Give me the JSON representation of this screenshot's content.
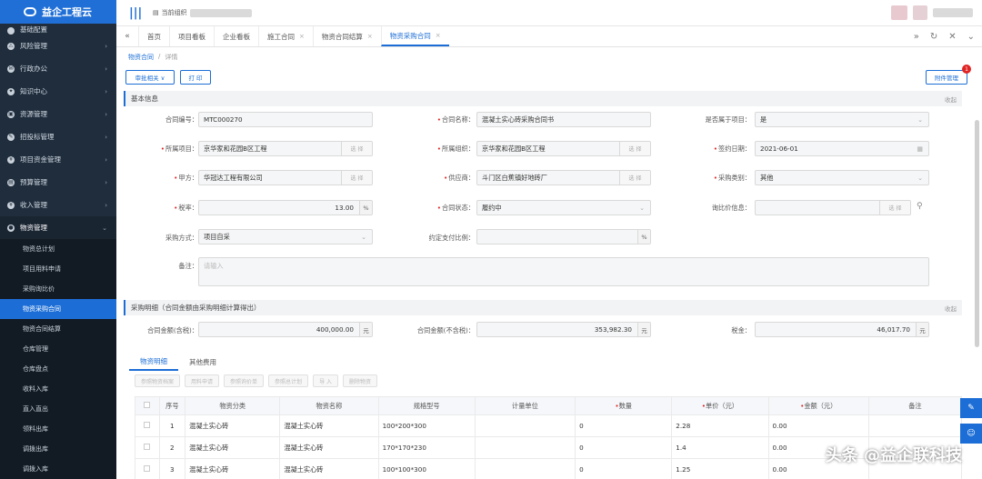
{
  "app": {
    "logo_text": "益企工程云",
    "current_org_label": "当前组织"
  },
  "sidebar": {
    "top_partial": "基础配置",
    "items": [
      {
        "label": "风险管理"
      },
      {
        "label": "行政办公"
      },
      {
        "label": "知识中心"
      },
      {
        "label": "资源管理"
      },
      {
        "label": "招投标管理"
      },
      {
        "label": "项目资金管理"
      },
      {
        "label": "预算管理"
      },
      {
        "label": "收入管理"
      },
      {
        "label": "物资管理"
      }
    ],
    "sub_items": [
      {
        "label": "物资总计划"
      },
      {
        "label": "项目用料申请"
      },
      {
        "label": "采购询比价"
      },
      {
        "label": "物资采购合同"
      },
      {
        "label": "物资合同结算"
      },
      {
        "label": "仓库管理"
      },
      {
        "label": "仓库盘点"
      },
      {
        "label": "收料入库"
      },
      {
        "label": "直入直出"
      },
      {
        "label": "领料出库"
      },
      {
        "label": "调拨出库"
      },
      {
        "label": "调拨入库"
      }
    ]
  },
  "tabs": [
    {
      "label": "首页",
      "closable": false
    },
    {
      "label": "项目看板",
      "closable": false
    },
    {
      "label": "企业看板",
      "closable": false
    },
    {
      "label": "施工合同",
      "closable": true
    },
    {
      "label": "物资合同结算",
      "closable": true
    },
    {
      "label": "物资采购合同",
      "closable": true,
      "active": true
    }
  ],
  "breadcrumb": {
    "parent": "物资合同",
    "sep": "/",
    "current": "详情"
  },
  "buttons": {
    "approval": "审批相关 ∨",
    "print": "打 印",
    "attachments": "附件管理",
    "attach_badge": "1"
  },
  "basic": {
    "title": "基本信息",
    "collapse": "收起",
    "contract_no_label": "合同编号：",
    "contract_no": "MTC000270",
    "contract_name_label": "合同名称：",
    "contract_name": "混凝土实心砖采购合同书",
    "belongs_project_label": "是否属于项目：",
    "belongs_project": "是",
    "project_label": "所属项目：",
    "project": "京华家和花园B区工程",
    "org_label": "所属组织：",
    "org": "京华家和花园B区工程",
    "sign_date_label": "签约日期：",
    "sign_date": "2021-06-01",
    "party_a_label": "甲方：",
    "party_a": "华冠达工程有限公司",
    "supplier_label": "供应商：",
    "supplier": "斗门区白蕉镇好地砖厂",
    "purchase_type_label": "采购类别：",
    "purchase_type": "其他",
    "tax_rate_label": "税率：",
    "tax_rate": "13.00",
    "percent": "%",
    "status_label": "合同状态：",
    "status": "履约中",
    "compare_label": "询比价信息：",
    "method_label": "采购方式：",
    "method": "项目自采",
    "pay_ratio_label": "约定支付比例：",
    "remark_label": "备注：",
    "remark_placeholder": "请输入",
    "select_btn": "选 择"
  },
  "detail": {
    "title": "采购明细（合同金额由采购明细计算得出）",
    "collapse": "收起",
    "amount_tax_label": "合同金额(含税)：",
    "amount_tax": "400,000.00",
    "amount_notax_label": "合同金额(不含税)：",
    "amount_notax": "353,982.30",
    "tax_label": "税金：",
    "tax": "46,017.70",
    "unit": "元"
  },
  "mtabs": [
    {
      "label": "物资明细",
      "active": true
    },
    {
      "label": "其他费用",
      "active": false
    }
  ],
  "toolbar": [
    "参照物资档案",
    "用料申请",
    "参照询价单",
    "参照总计划",
    "导 入",
    "删除物资"
  ],
  "table": {
    "headers": [
      "序号",
      "物资分类",
      "物资名称",
      "规格型号",
      "计量单位",
      "数量",
      "单价（元）",
      "金额（元）",
      "备注"
    ],
    "rows": [
      {
        "no": "1",
        "cat": "混凝土实心砖",
        "name": "混凝土实心砖",
        "spec": "100*200*300",
        "unit": "",
        "qty": "0",
        "price": "2.28",
        "amount": "0.00",
        "note": ""
      },
      {
        "no": "2",
        "cat": "混凝土实心砖",
        "name": "混凝土实心砖",
        "spec": "170*170*230",
        "unit": "",
        "qty": "0",
        "price": "1.4",
        "amount": "0.00",
        "note": ""
      },
      {
        "no": "3",
        "cat": "混凝土实心砖",
        "name": "混凝土实心砖",
        "spec": "100*100*300",
        "unit": "",
        "qty": "0",
        "price": "1.25",
        "amount": "0.00",
        "note": ""
      }
    ]
  },
  "watermark": "头条 @益企联科技"
}
